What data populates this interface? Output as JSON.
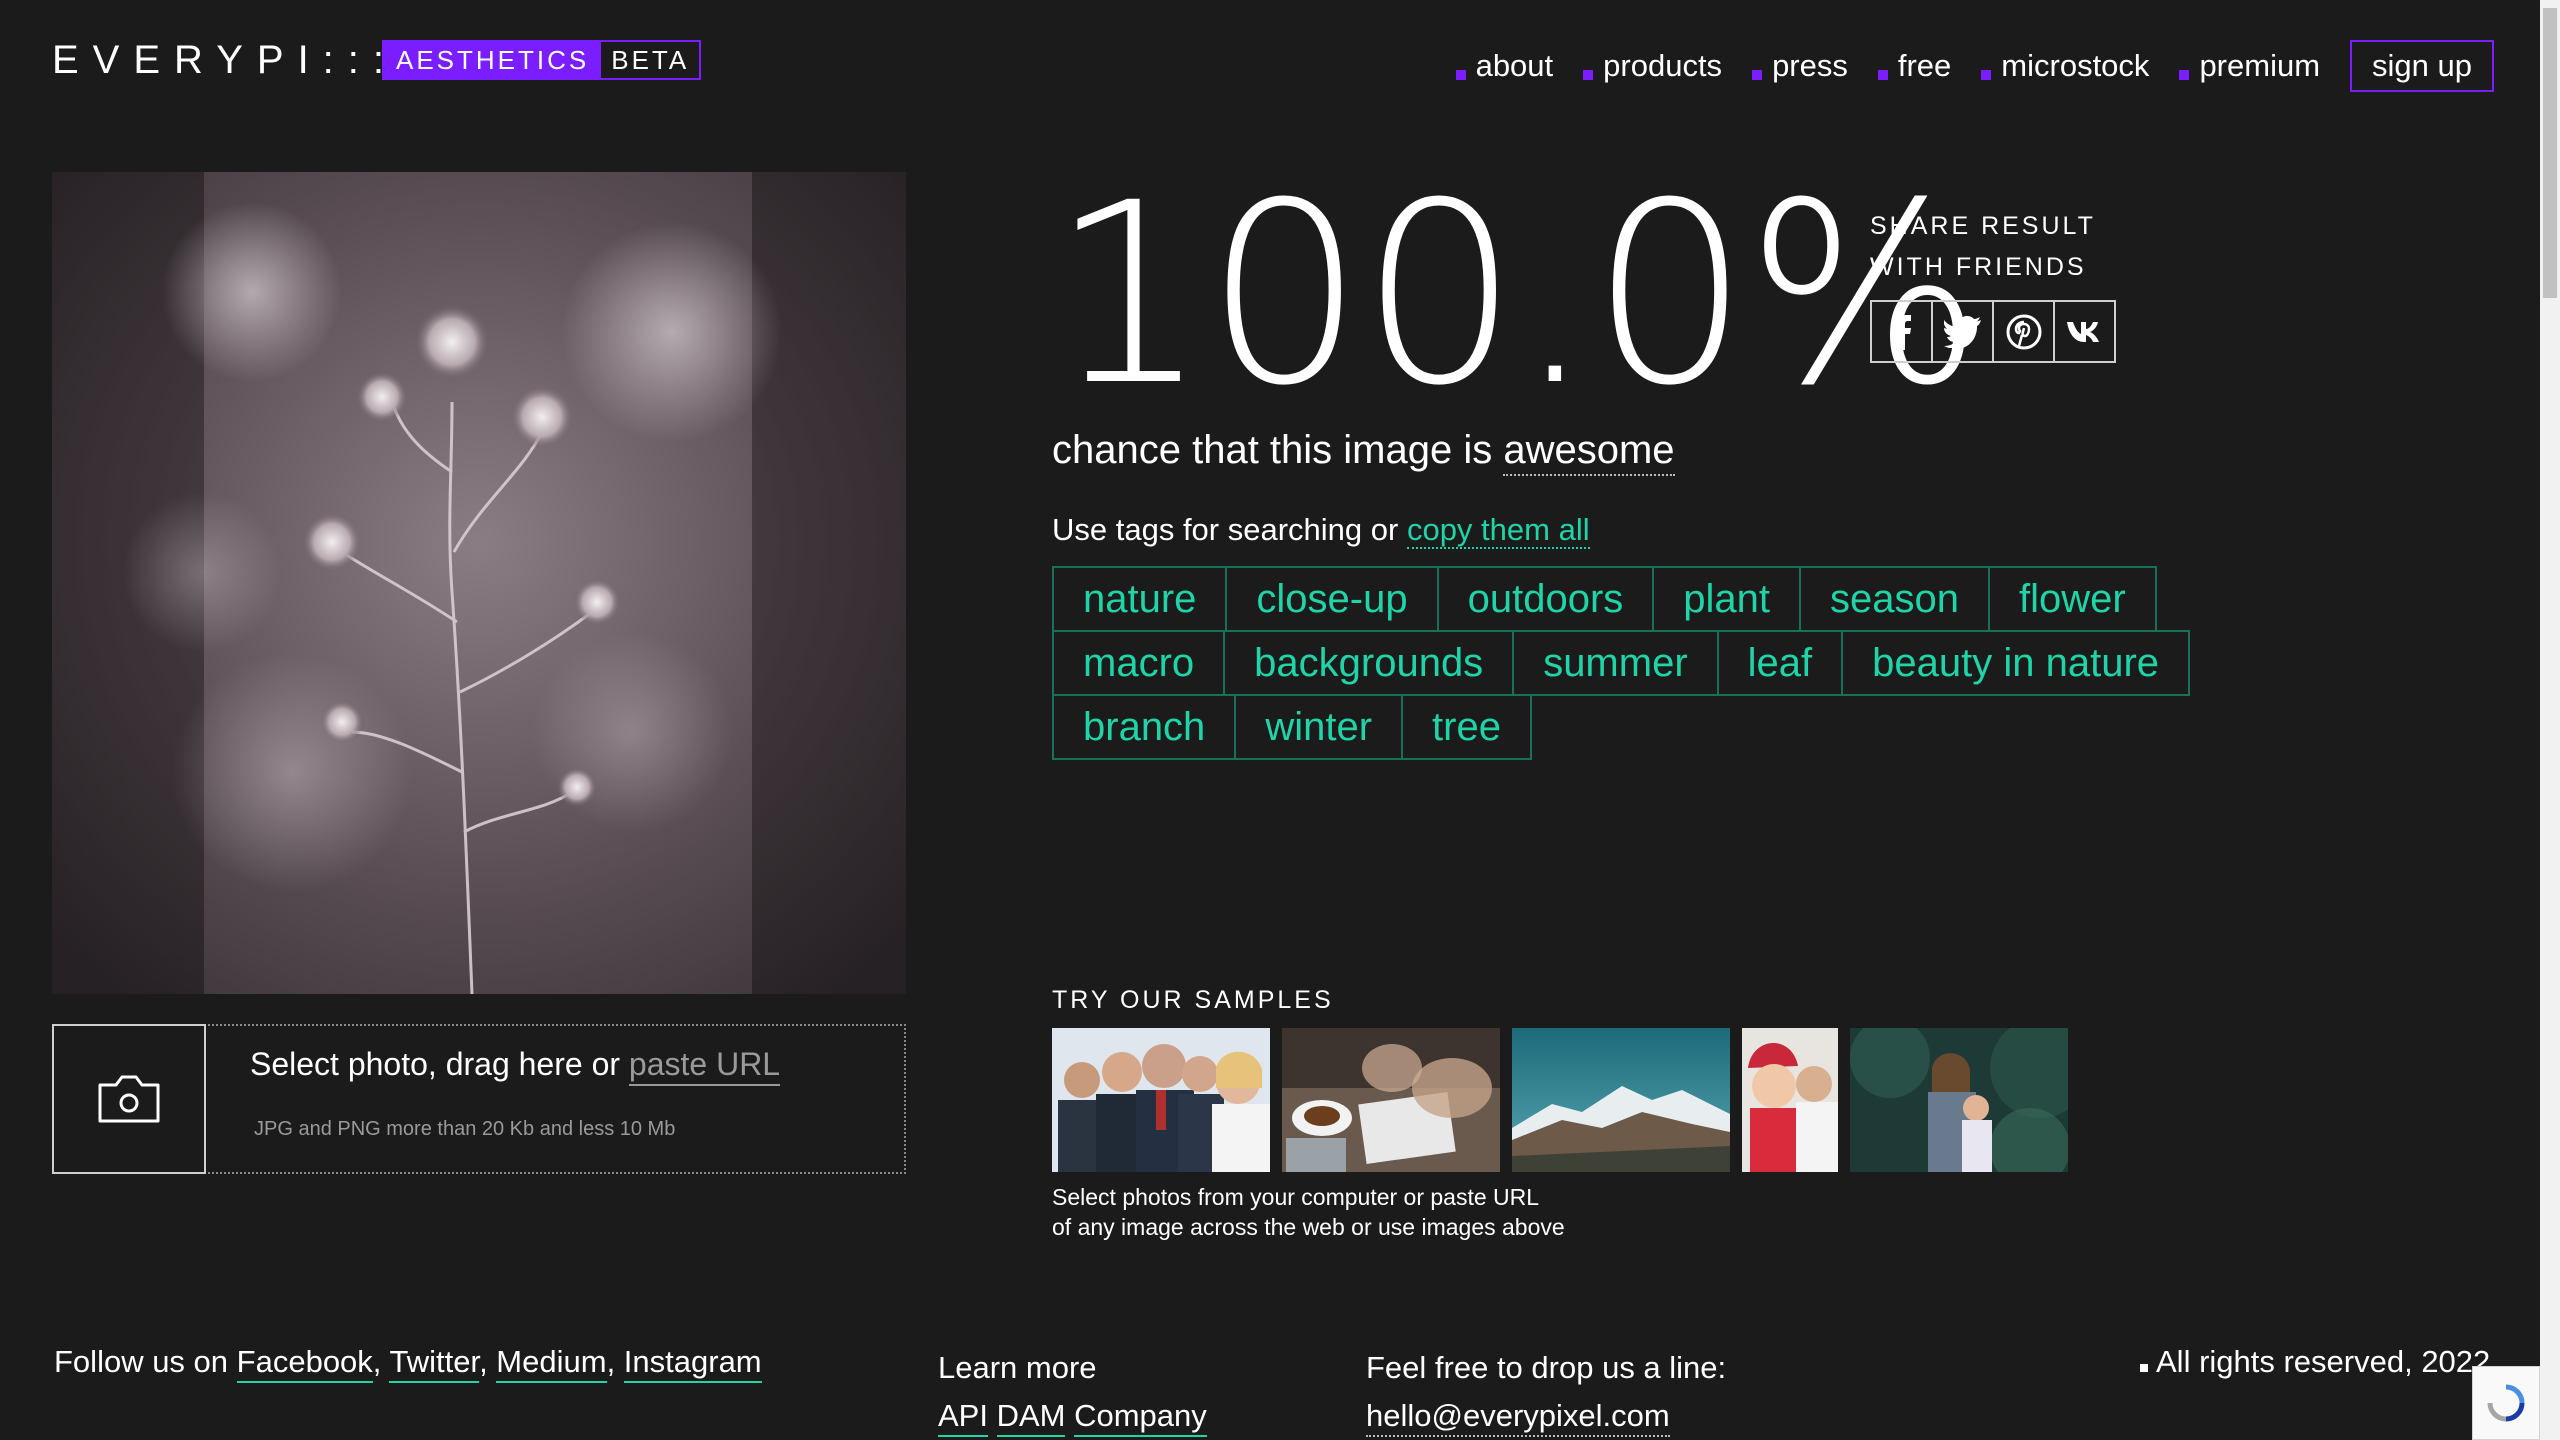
{
  "header": {
    "logo_word": "EVERYPI:::EL",
    "logo_aesthetics": "AESTHETICS",
    "logo_beta": "BETA",
    "nav": [
      {
        "label": "about"
      },
      {
        "label": "products"
      },
      {
        "label": "press"
      },
      {
        "label": "free"
      },
      {
        "label": "microstock"
      },
      {
        "label": "premium"
      }
    ],
    "signup_label": "sign up"
  },
  "upload": {
    "prompt": "Select photo, drag here or",
    "paste_link": "paste URL",
    "hint": "JPG and PNG more than 20 Kb and less 10 Mb"
  },
  "result": {
    "score": "100.0%",
    "share_line1": "SHARE RESULT",
    "share_line2": "WITH FRIENDS",
    "chance_prefix": "chance that this image is",
    "chance_word": "awesome",
    "tags_prefix": "Use tags for searching or",
    "tags_link": "copy them all",
    "tag_rows": [
      [
        "nature",
        "close-up",
        "outdoors",
        "plant",
        "season",
        "flower"
      ],
      [
        "macro",
        "backgrounds",
        "summer",
        "leaf",
        "beauty in nature"
      ],
      [
        "branch",
        "winter",
        "tree"
      ]
    ],
    "share_icons": [
      "facebook-icon",
      "twitter-icon",
      "pinterest-icon",
      "vk-icon"
    ]
  },
  "samples": {
    "title": "TRY OUR SAMPLES",
    "caption_line1": "Select photos from your computer or paste URL",
    "caption_line2": "of any image across the web or use images above"
  },
  "footer": {
    "follow_prefix": "Follow us on",
    "facebook": "Facebook",
    "twitter": "Twitter",
    "medium": "Medium",
    "instagram": "Instagram",
    "learn_more": "Learn more",
    "api": "API",
    "dam": "DAM",
    "company": "Company",
    "drop_line": "Feel free to drop us a line:",
    "email": "hello@everypixel.com",
    "rights": "All rights reserved, 2022"
  },
  "colors": {
    "background": "#1c1b1c",
    "accent_purple": "#7a1dff",
    "accent_green": "#1fd4a7"
  }
}
